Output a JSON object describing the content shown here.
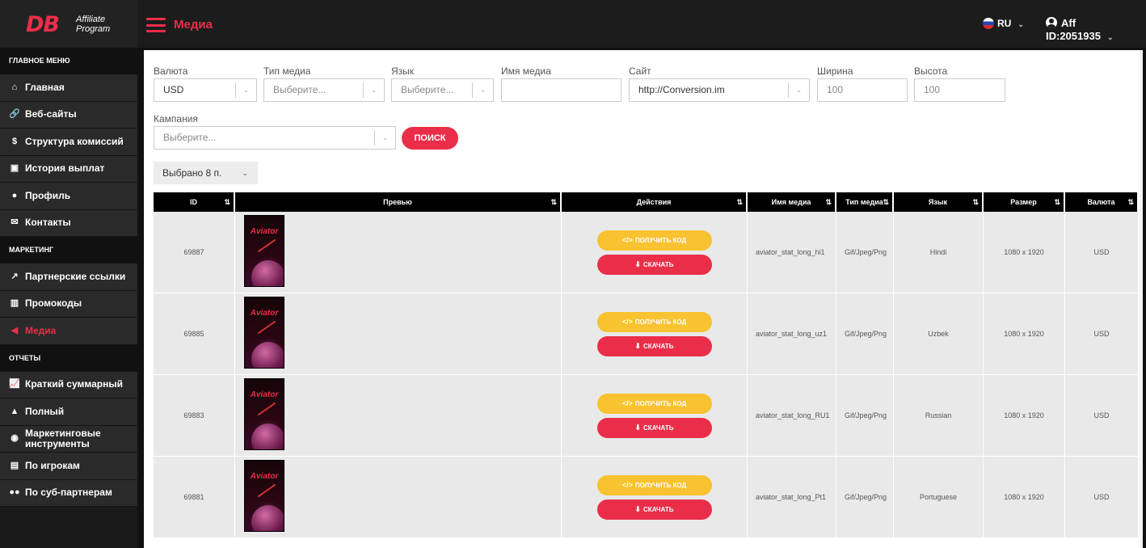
{
  "brand": {
    "logo": "DB",
    "sub1": "Affiliate",
    "sub2": "Program"
  },
  "header": {
    "title": "Медиа",
    "lang": "RU",
    "account": "Aff ID:2051935"
  },
  "sidebar": {
    "sections": [
      {
        "title": "ГЛАВНОЕ МЕНЮ",
        "items": [
          {
            "label": "Главная",
            "icon": "home-icon",
            "glyph": "⌂"
          },
          {
            "label": "Веб-сайты",
            "icon": "link-icon",
            "glyph": "🔗"
          },
          {
            "label": "Структура комиссий",
            "icon": "dollar-icon",
            "glyph": "$"
          },
          {
            "label": "История выплат",
            "icon": "money-icon",
            "glyph": "▣"
          },
          {
            "label": "Профиль",
            "icon": "user-icon",
            "glyph": "●"
          },
          {
            "label": "Контакты",
            "icon": "envelope-icon",
            "glyph": "✉"
          }
        ]
      },
      {
        "title": "МАРКЕТИНГ",
        "items": [
          {
            "label": "Партнерские ссылки",
            "icon": "external-link-icon",
            "glyph": "↗"
          },
          {
            "label": "Промокоды",
            "icon": "barcode-icon",
            "glyph": "▥"
          },
          {
            "label": "Медиа",
            "icon": "megaphone-icon",
            "glyph": "◀",
            "active": true
          }
        ]
      },
      {
        "title": "ОТЧЕТЫ",
        "items": [
          {
            "label": "Краткий суммарный",
            "icon": "line-chart-icon",
            "glyph": "📈"
          },
          {
            "label": "Полный",
            "icon": "area-chart-icon",
            "glyph": "▲"
          },
          {
            "label": "Маркетинговые инструменты",
            "icon": "palette-icon",
            "glyph": "◉"
          },
          {
            "label": "По игрокам",
            "icon": "id-card-icon",
            "glyph": "▤"
          },
          {
            "label": "По суб-партнерам",
            "icon": "users-icon",
            "glyph": "●●"
          }
        ]
      }
    ]
  },
  "filters": {
    "currency": {
      "label": "Валюта",
      "value": "USD"
    },
    "media_type": {
      "label": "Тип медиа",
      "placeholder": "Выберите..."
    },
    "language": {
      "label": "Язык",
      "placeholder": "Выберите..."
    },
    "media_name": {
      "label": "Имя медиа",
      "value": ""
    },
    "site": {
      "label": "Сайт",
      "value": "http://Conversion.im"
    },
    "width": {
      "label": "Ширина",
      "placeholder": "100"
    },
    "height": {
      "label": "Высота",
      "placeholder": "100"
    },
    "campaign": {
      "label": "Кампания",
      "placeholder": "Выберите..."
    },
    "search_label": "ПОИСК",
    "selected_label": "Выбрано 8 п."
  },
  "table": {
    "columns": [
      "ID",
      "Превью",
      "Действия",
      "Имя медиа",
      "Тип медиа",
      "Язык",
      "Размер",
      "Валюта"
    ],
    "get_code_label": "ПОЛУЧИТЬ КОД",
    "download_label": "СКАЧАТЬ",
    "preview_brand": "Aviator",
    "rows": [
      {
        "id": "69887",
        "name": "aviator_stat_long_hi1",
        "type": "Gif/Jpeg/Png",
        "lang": "Hindi",
        "size": "1080 x 1920",
        "currency": "USD"
      },
      {
        "id": "69885",
        "name": "aviator_stat_long_uz1",
        "type": "Gif/Jpeg/Png",
        "lang": "Uzbek",
        "size": "1080 x 1920",
        "currency": "USD"
      },
      {
        "id": "69883",
        "name": "aviator_stat_long_RU1",
        "type": "Gif/Jpeg/Png",
        "lang": "Russian",
        "size": "1080 x 1920",
        "currency": "USD"
      },
      {
        "id": "69881",
        "name": "aviator_stat_long_Pt1",
        "type": "Gif/Jpeg/Png",
        "lang": "Portuguese",
        "size": "1080 x 1920",
        "currency": "USD"
      }
    ]
  }
}
